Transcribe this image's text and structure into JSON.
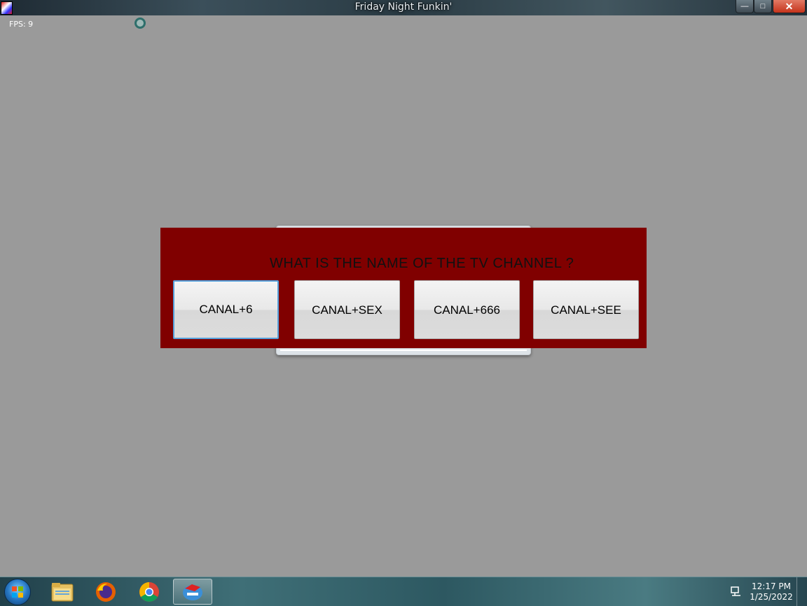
{
  "window": {
    "title": "Friday Night Funkin'",
    "controls": {
      "minimize": "—",
      "maximize": "□",
      "close": "✕"
    }
  },
  "game": {
    "fps_label": "FPS: 9"
  },
  "dialog": {
    "question": "WHAT IS THE NAME OF THE TV CHANNEL ?",
    "answers": [
      "CANAL+6",
      "CANAL+SEX",
      "CANAL+666",
      "CANAL+SEE"
    ],
    "focused_answer_index": 0,
    "panel_color": "#800000"
  },
  "taskbar": {
    "apps": [
      "start-button",
      "file-explorer-icon",
      "firefox-icon",
      "chrome-icon",
      "friday-night-funkin-icon"
    ],
    "active_app": "friday-night-funkin-icon",
    "clock_time": "12:17 PM",
    "clock_date": "1/25/2022"
  }
}
